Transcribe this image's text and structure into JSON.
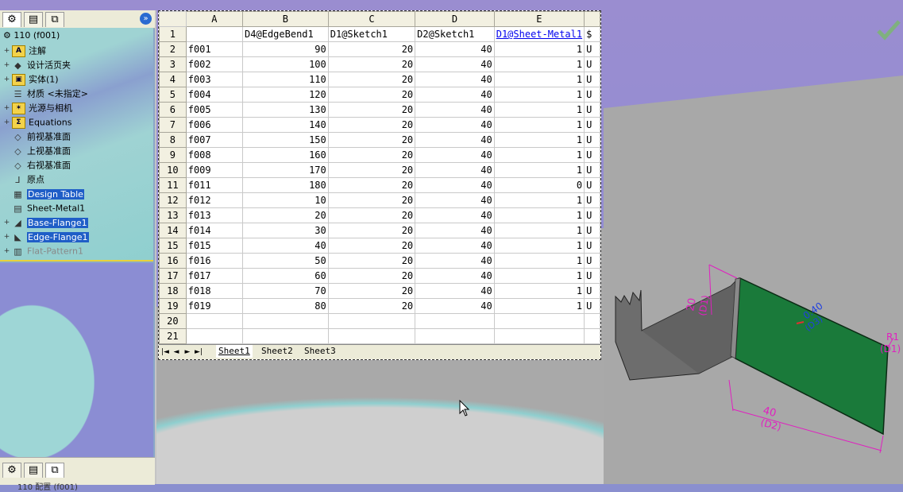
{
  "feature_manager": {
    "root_label": "110  (f001)",
    "expand_glyph": "»",
    "items": [
      {
        "label": "注解",
        "icon": "annotations-icon",
        "glyph": "A",
        "expand": "+",
        "state": ""
      },
      {
        "label": "设计活页夹",
        "icon": "design-binder-icon",
        "glyph": "◆",
        "expand": "+",
        "state": ""
      },
      {
        "label": "实体(1)",
        "icon": "solid-bodies-icon",
        "glyph": "▣",
        "expand": "+",
        "state": ""
      },
      {
        "label": "材质 <未指定>",
        "icon": "material-icon",
        "glyph": "☰",
        "expand": "",
        "state": ""
      },
      {
        "label": "光源与相机",
        "icon": "lights-cameras-icon",
        "glyph": "✶",
        "expand": "+",
        "state": ""
      },
      {
        "label": "Equations",
        "icon": "equations-icon",
        "glyph": "Σ",
        "expand": "+",
        "state": ""
      },
      {
        "label": "前视基准面",
        "icon": "plane-icon",
        "glyph": "◇",
        "expand": "",
        "state": ""
      },
      {
        "label": "上视基准面",
        "icon": "plane-icon",
        "glyph": "◇",
        "expand": "",
        "state": ""
      },
      {
        "label": "右视基准面",
        "icon": "plane-icon",
        "glyph": "◇",
        "expand": "",
        "state": ""
      },
      {
        "label": "原点",
        "icon": "origin-icon",
        "glyph": "⅃",
        "expand": "",
        "state": ""
      },
      {
        "label": "Design Table",
        "icon": "design-table-icon",
        "glyph": "▦",
        "expand": "",
        "state": "hl"
      },
      {
        "label": "Sheet-Metal1",
        "icon": "sheet-metal-icon",
        "glyph": "▤",
        "expand": "",
        "state": ""
      },
      {
        "label": "Base-Flange1",
        "icon": "base-flange-icon",
        "glyph": "◢",
        "expand": "+",
        "state": "hl"
      },
      {
        "label": "Edge-Flange1",
        "icon": "edge-flange-icon",
        "glyph": "◣",
        "expand": "+",
        "state": "hl"
      },
      {
        "label": "Flat-Pattern1",
        "icon": "flat-pattern-icon",
        "glyph": "▥",
        "expand": "+",
        "state": "dim"
      }
    ],
    "bottom_sub": "110 配置 (f001)"
  },
  "spreadsheet": {
    "columns": [
      "A",
      "B",
      "C",
      "D",
      "E",
      ""
    ],
    "header_row": [
      "",
      "D4@EdgeBend1",
      "D1@Sketch1",
      "D2@Sketch1",
      "D1@Sheet-Metal1",
      "$"
    ],
    "rows": [
      [
        "f001",
        "90",
        "20",
        "40",
        "1",
        "U"
      ],
      [
        "f002",
        "100",
        "20",
        "40",
        "1",
        "U"
      ],
      [
        "f003",
        "110",
        "20",
        "40",
        "1",
        "U"
      ],
      [
        "f004",
        "120",
        "20",
        "40",
        "1",
        "U"
      ],
      [
        "f005",
        "130",
        "20",
        "40",
        "1",
        "U"
      ],
      [
        "f006",
        "140",
        "20",
        "40",
        "1",
        "U"
      ],
      [
        "f007",
        "150",
        "20",
        "40",
        "1",
        "U"
      ],
      [
        "f008",
        "160",
        "20",
        "40",
        "1",
        "U"
      ],
      [
        "f009",
        "170",
        "20",
        "40",
        "1",
        "U"
      ],
      [
        "f011",
        "180",
        "20",
        "40",
        "0",
        "U"
      ],
      [
        "f012",
        "10",
        "20",
        "40",
        "1",
        "U"
      ],
      [
        "f013",
        "20",
        "20",
        "40",
        "1",
        "U"
      ],
      [
        "f014",
        "30",
        "20",
        "40",
        "1",
        "U"
      ],
      [
        "f015",
        "40",
        "20",
        "40",
        "1",
        "U"
      ],
      [
        "f016",
        "50",
        "20",
        "40",
        "1",
        "U"
      ],
      [
        "f017",
        "60",
        "20",
        "40",
        "1",
        "U"
      ],
      [
        "f018",
        "70",
        "20",
        "40",
        "1",
        "U"
      ],
      [
        "f019",
        "80",
        "20",
        "40",
        "1",
        "U"
      ],
      [
        "",
        "",
        "",
        "",
        "",
        ""
      ],
      [
        "",
        "",
        "",
        "",
        "",
        ""
      ]
    ],
    "sheet_tabs": [
      "Sheet1",
      "Sheet2",
      "Sheet3"
    ],
    "nav_glyphs": [
      "|◄",
      "◄",
      "►",
      "►|"
    ]
  },
  "viewport": {
    "dim_height": "20",
    "dim_height_name": "(D1)",
    "dim_width": "40",
    "dim_width_name": "(D2)",
    "dim_angle": "0.40",
    "dim_angle_name": "(D3)",
    "dim_radius": "R1",
    "dim_radius_name": "(D1)",
    "colors": {
      "flange": "#1a7a3a",
      "dimension": "#e020c0",
      "part": "#6d6d6d"
    }
  }
}
